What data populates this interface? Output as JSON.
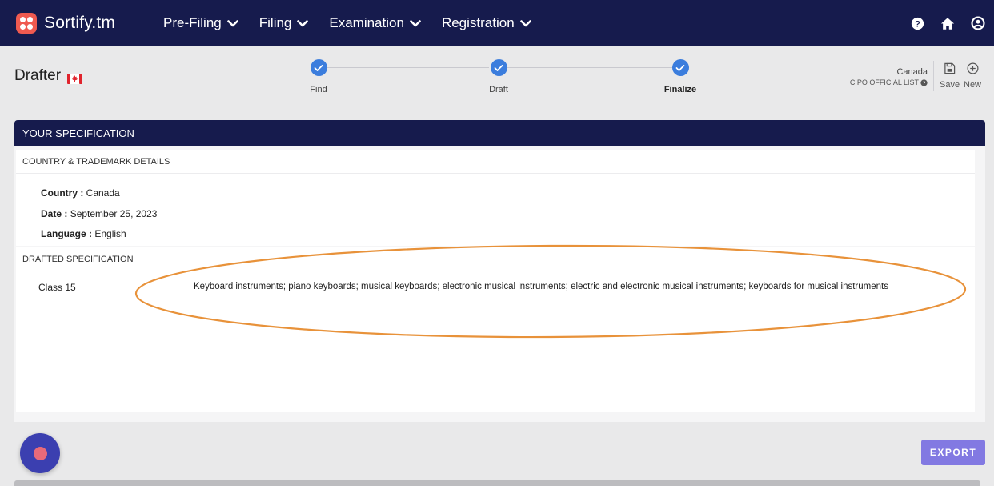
{
  "app": {
    "title": "Sortify.tm"
  },
  "nav": {
    "items": [
      {
        "label": "Pre-Filing"
      },
      {
        "label": "Filing"
      },
      {
        "label": "Examination"
      },
      {
        "label": "Registration"
      }
    ],
    "icons": [
      "help-icon",
      "home-icon",
      "user-icon"
    ]
  },
  "page": {
    "title": "Drafter",
    "flag_icon": "canada-flag-icon"
  },
  "stepper": {
    "steps": [
      {
        "label": "Find",
        "state": "complete"
      },
      {
        "label": "Draft",
        "state": "complete"
      },
      {
        "label": "Finalize",
        "state": "complete",
        "active": true
      }
    ]
  },
  "source": {
    "country": "Canada",
    "list": "CIPO OFFICIAL LIST"
  },
  "actions": {
    "save_label": "Save",
    "new_label": "New"
  },
  "spec": {
    "header": "YOUR SPECIFICATION",
    "details_title": "COUNTRY & TRADEMARK DETAILS",
    "details": {
      "country_label": "Country :",
      "country_value": "Canada",
      "date_label": "Date :",
      "date_value": "September 25, 2023",
      "language_label": "Language :",
      "language_value": "English"
    },
    "drafted_title": "DRAFTED SPECIFICATION",
    "classes": [
      {
        "class_label": "Class 15",
        "text": "Keyboard instruments; piano keyboards; musical keyboards; electronic musical instruments; electric and electronic musical instruments; keyboards for musical instruments"
      }
    ]
  },
  "export_label": "EXPORT",
  "colors": {
    "navbar": "#161b4d",
    "accent": "#3b7ddd",
    "export": "#8279e2",
    "annotation": "#e8923a"
  }
}
